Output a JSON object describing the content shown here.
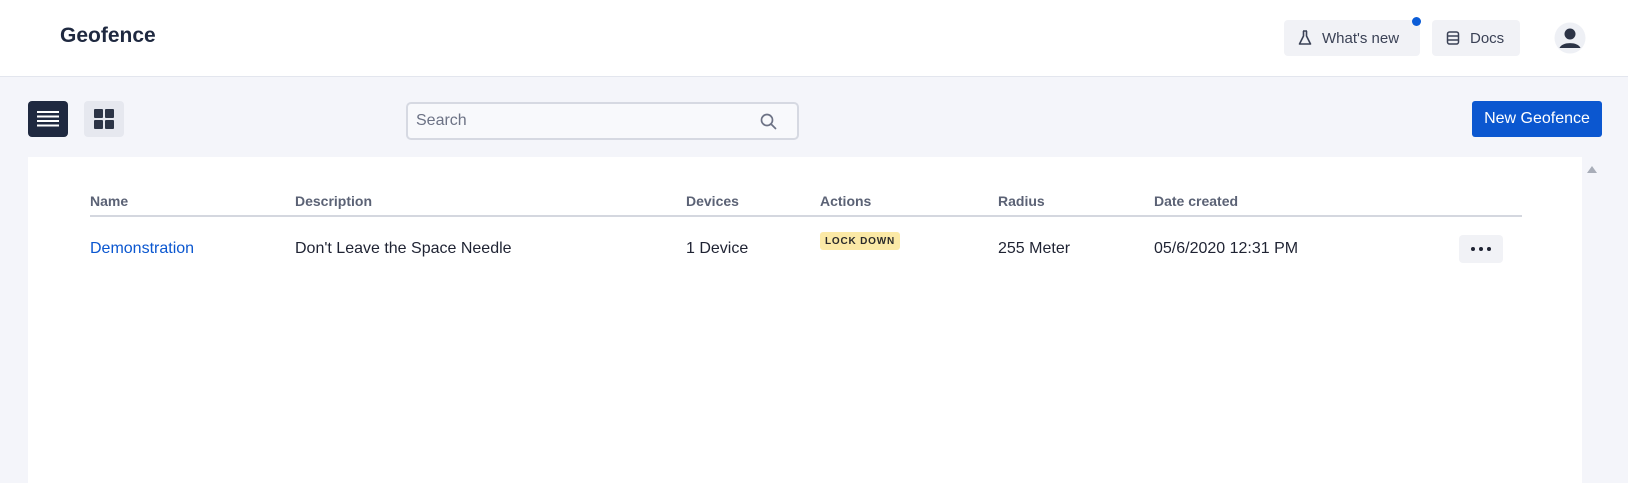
{
  "app": {
    "title": "Geofence"
  },
  "header": {
    "whats_new_label": "What's new",
    "docs_label": "Docs",
    "has_notification": true
  },
  "toolbar": {
    "search_placeholder": "Search",
    "search_value": "",
    "new_button_label": "New Geofence",
    "active_view": "list"
  },
  "table": {
    "columns": [
      "Name",
      "Description",
      "Devices",
      "Actions",
      "Radius",
      "Date created"
    ],
    "rows": [
      {
        "name": "Demonstration",
        "description": "Don't Leave the Space Needle",
        "devices": "1 Device",
        "action": "LOCK DOWN",
        "radius": "255 Meter",
        "date_created": "05/6/2020 12:31 PM"
      }
    ]
  },
  "colors": {
    "accent": "#0b57d0",
    "nav_dark": "#1f2940",
    "badge_bg": "#fbe9a6",
    "page_bg": "#f4f5fa"
  },
  "icons": {
    "whats_new": "flask-icon",
    "docs": "book-stack-icon",
    "avatar": "user-avatar-icon",
    "list_view": "list-view-icon",
    "grid_view": "grid-view-icon",
    "search": "search-icon",
    "more": "more-horizontal-icon",
    "scroll_up": "scroll-up-arrow-icon"
  }
}
